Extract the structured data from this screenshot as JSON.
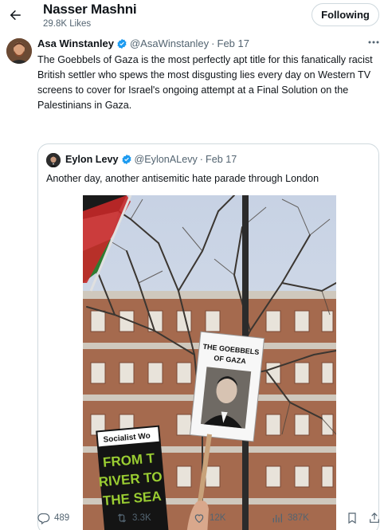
{
  "header": {
    "title": "Nasser Mashni",
    "likes": "29.8K Likes",
    "follow_label": "Following"
  },
  "tweet": {
    "name": "Asa Winstanley",
    "handle": "@AsaWinstanley",
    "separator": "·",
    "date": "Feb 17",
    "text": "The Goebbels of Gaza is the most perfectly apt title for this fanatically racist British settler who spews the most disgusting lies every day on Western TV screens to cover for Israel's ongoing attempt at a Final Solution on the Palestinians in Gaza."
  },
  "quote": {
    "name": "Eylon Levy",
    "handle": "@EylonALevy",
    "separator": "·",
    "date": "Feb 17",
    "text": "Another day, another antisemitic hate parade through London",
    "image": {
      "placard_text_line1": "THE GOEBBELS",
      "placard_text_line2": "OF GAZA",
      "sign_text_header": "Socialist Wo",
      "sign_text_line1": "FROM T",
      "sign_text_line2": "RIVER TO",
      "sign_text_line3": "THE SEA"
    }
  },
  "actions": {
    "replies": "489",
    "reposts": "3.3K",
    "likes": "12K",
    "views": "387K"
  },
  "colors": {
    "verified": "#1d9bf0",
    "muted": "#536471",
    "border": "#cfd9de"
  },
  "icons": [
    "back-arrow-icon",
    "verified-badge-icon",
    "more-icon",
    "reply-icon",
    "repost-icon",
    "like-icon",
    "views-icon",
    "bookmark-icon",
    "share-icon"
  ]
}
